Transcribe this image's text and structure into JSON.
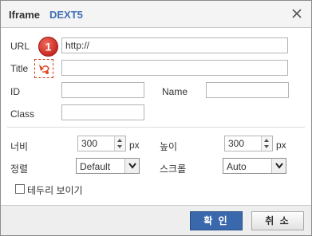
{
  "dialog": {
    "title": "Iframe",
    "brand": "DEXT5",
    "close_icon": "close-icon"
  },
  "form": {
    "url": {
      "label": "URL",
      "value": "http://"
    },
    "title": {
      "label": "Title",
      "value": ""
    },
    "badge": {
      "number": "1",
      "color": "#d9342b"
    },
    "id": {
      "label": "ID",
      "value": ""
    },
    "name": {
      "label": "Name",
      "value": ""
    },
    "class": {
      "label": "Class",
      "value": ""
    },
    "width": {
      "label": "너비",
      "value": "300",
      "unit": "px"
    },
    "height": {
      "label": "높이",
      "value": "300",
      "unit": "px"
    },
    "align": {
      "label": "정렬",
      "selected": "Default"
    },
    "scroll": {
      "label": "스크롤",
      "selected": "Auto"
    },
    "border": {
      "label": "테두리 보이기",
      "checked": false
    }
  },
  "footer": {
    "ok_label": "확 인",
    "cancel_label": "취 소",
    "ok_color": "#3a68ac"
  }
}
